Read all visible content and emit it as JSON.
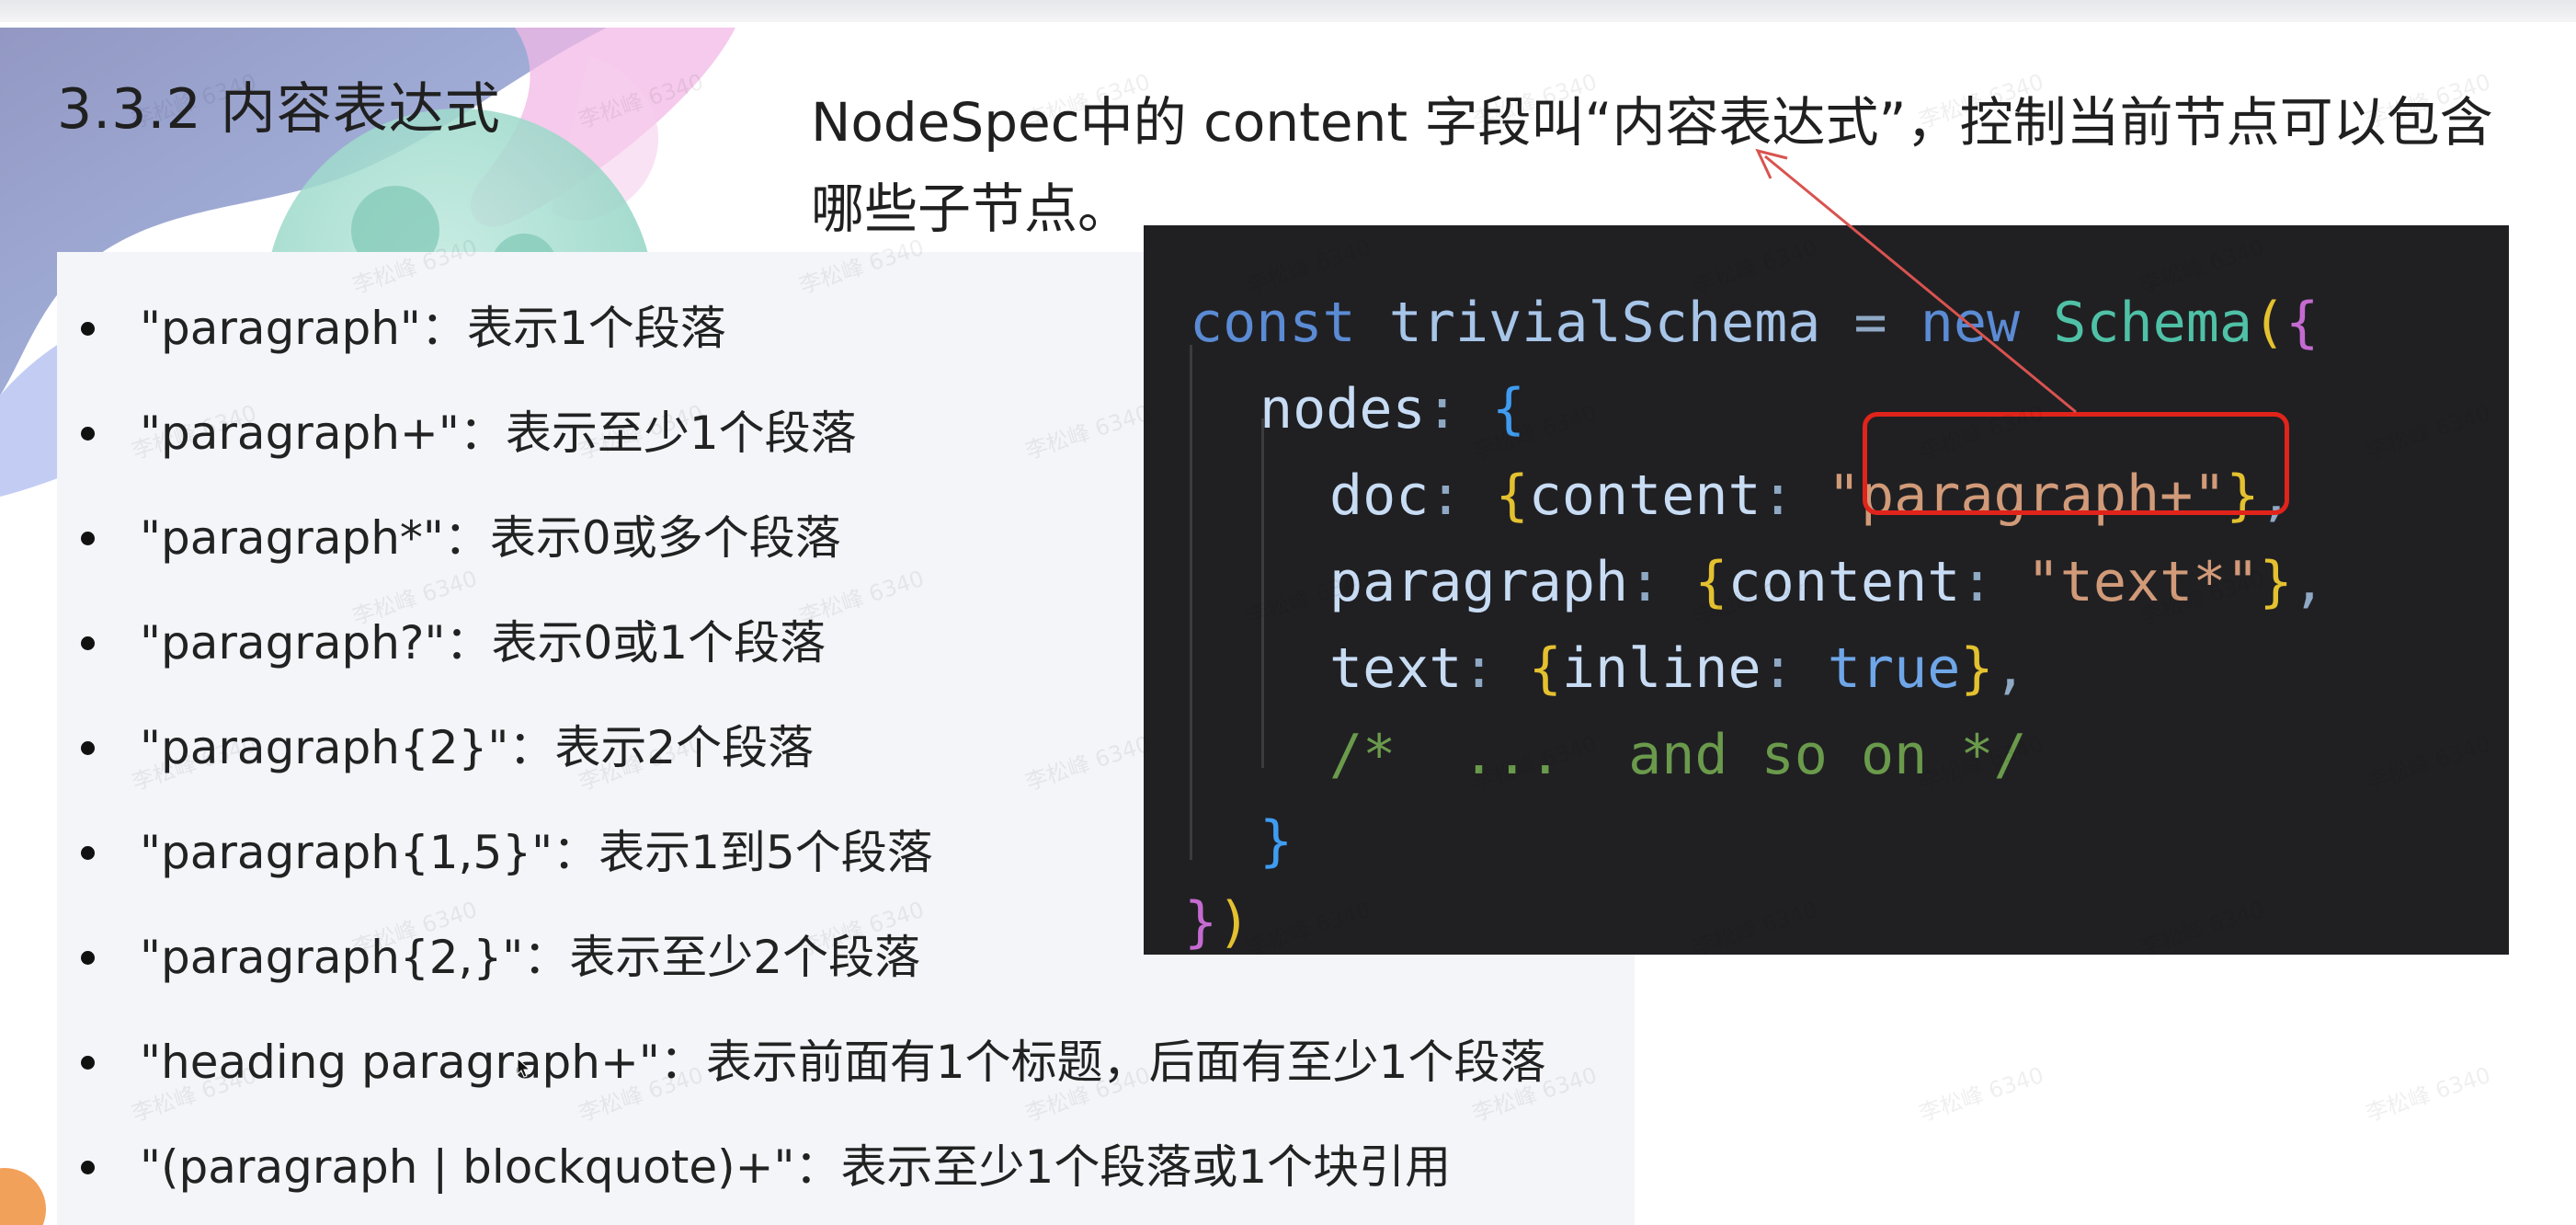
{
  "slide": {
    "heading": "3.3.2 内容表达式",
    "description_line1": "NodeSpec中的 content 字段叫“内容表达式”，控制当前节点可以包含",
    "description_line2": "哪些子节点。",
    "bullets": [
      "\"paragraph\"：表示1个段落",
      "\"paragraph+\"：表示至少1个段落",
      "\"paragraph*\"：表示0或多个段落",
      "\"paragraph?\"：表示0或1个段落",
      "\"paragraph{2}\"：表示2个段落",
      "\"paragraph{1,5}\"：表示1到5个段落",
      "\"paragraph{2,}\"：表示至少2个段落",
      "\"heading paragraph+\"：表示前面有1个标题，后面有至少1个段落",
      "\"(paragraph | blockquote)+\"：表示至少1个段落或1个块引用"
    ],
    "watermark": "李松峰 6340"
  },
  "code": {
    "l1_const": "const",
    "l1_name": "trivialSchema",
    "l1_eq": "=",
    "l1_new": "new",
    "l1_class": "Schema",
    "l1_paren": "(",
    "l1_brace": "{",
    "l2_key": "nodes",
    "l2_colon": ":",
    "l2_brace": "{",
    "l3_key": "doc",
    "l3_colon": ":",
    "l3_open": "{",
    "l3_prop": "content",
    "l3_colon2": ":",
    "l3_str": "\"paragraph+\"",
    "l3_close": "}",
    "l3_comma": ",",
    "l4_key": "paragraph",
    "l4_colon": ":",
    "l4_open": "{",
    "l4_prop": "content",
    "l4_colon2": ":",
    "l4_str": "\"text*\"",
    "l4_close": "}",
    "l4_comma": ",",
    "l5_key": "text",
    "l5_colon": ":",
    "l5_open": "{",
    "l5_prop": "inline",
    "l5_colon2": ":",
    "l5_bool": "true",
    "l5_close": "}",
    "l5_comma": ",",
    "l6_comment": "/*  ...  and so on */",
    "l7_brace": "}",
    "l8_brace": "}",
    "l8_paren": ")"
  },
  "colors": {
    "highlight_box": "#e0241b",
    "annotation_arrow": "#d9534f",
    "code_background": "#202023"
  }
}
